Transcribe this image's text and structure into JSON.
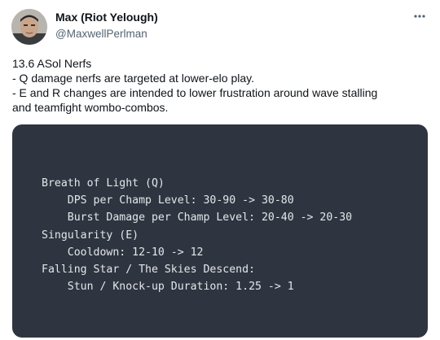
{
  "author": {
    "display_name": "Max (Riot Yelough)",
    "handle": "@MaxwellPerlman",
    "avatar_icon": "avatar-photo"
  },
  "more_icon": "more-horizontal-icon",
  "tweet": {
    "lines": [
      "13.6 ASol Nerfs",
      "- Q damage nerfs are targeted at lower-elo play.",
      "- E and R changes are intended to lower frustration around wave stalling",
      "and teamfight wombo-combos."
    ]
  },
  "patch_notes": {
    "lines": [
      "Breath of Light (Q)",
      "    DPS per Champ Level: 30-90 -> 30-80",
      "    Burst Damage per Champ Level: 20-40 -> 20-30",
      "Singularity (E)",
      "    Cooldown: 12-10 -> 12",
      "Falling Star / The Skies Descend:",
      "    Stun / Knock-up Duration: 1.25 -> 1"
    ]
  },
  "colors": {
    "code_background": "#2f3540",
    "code_text": "#e4e6ea",
    "secondary_text": "#536471"
  }
}
